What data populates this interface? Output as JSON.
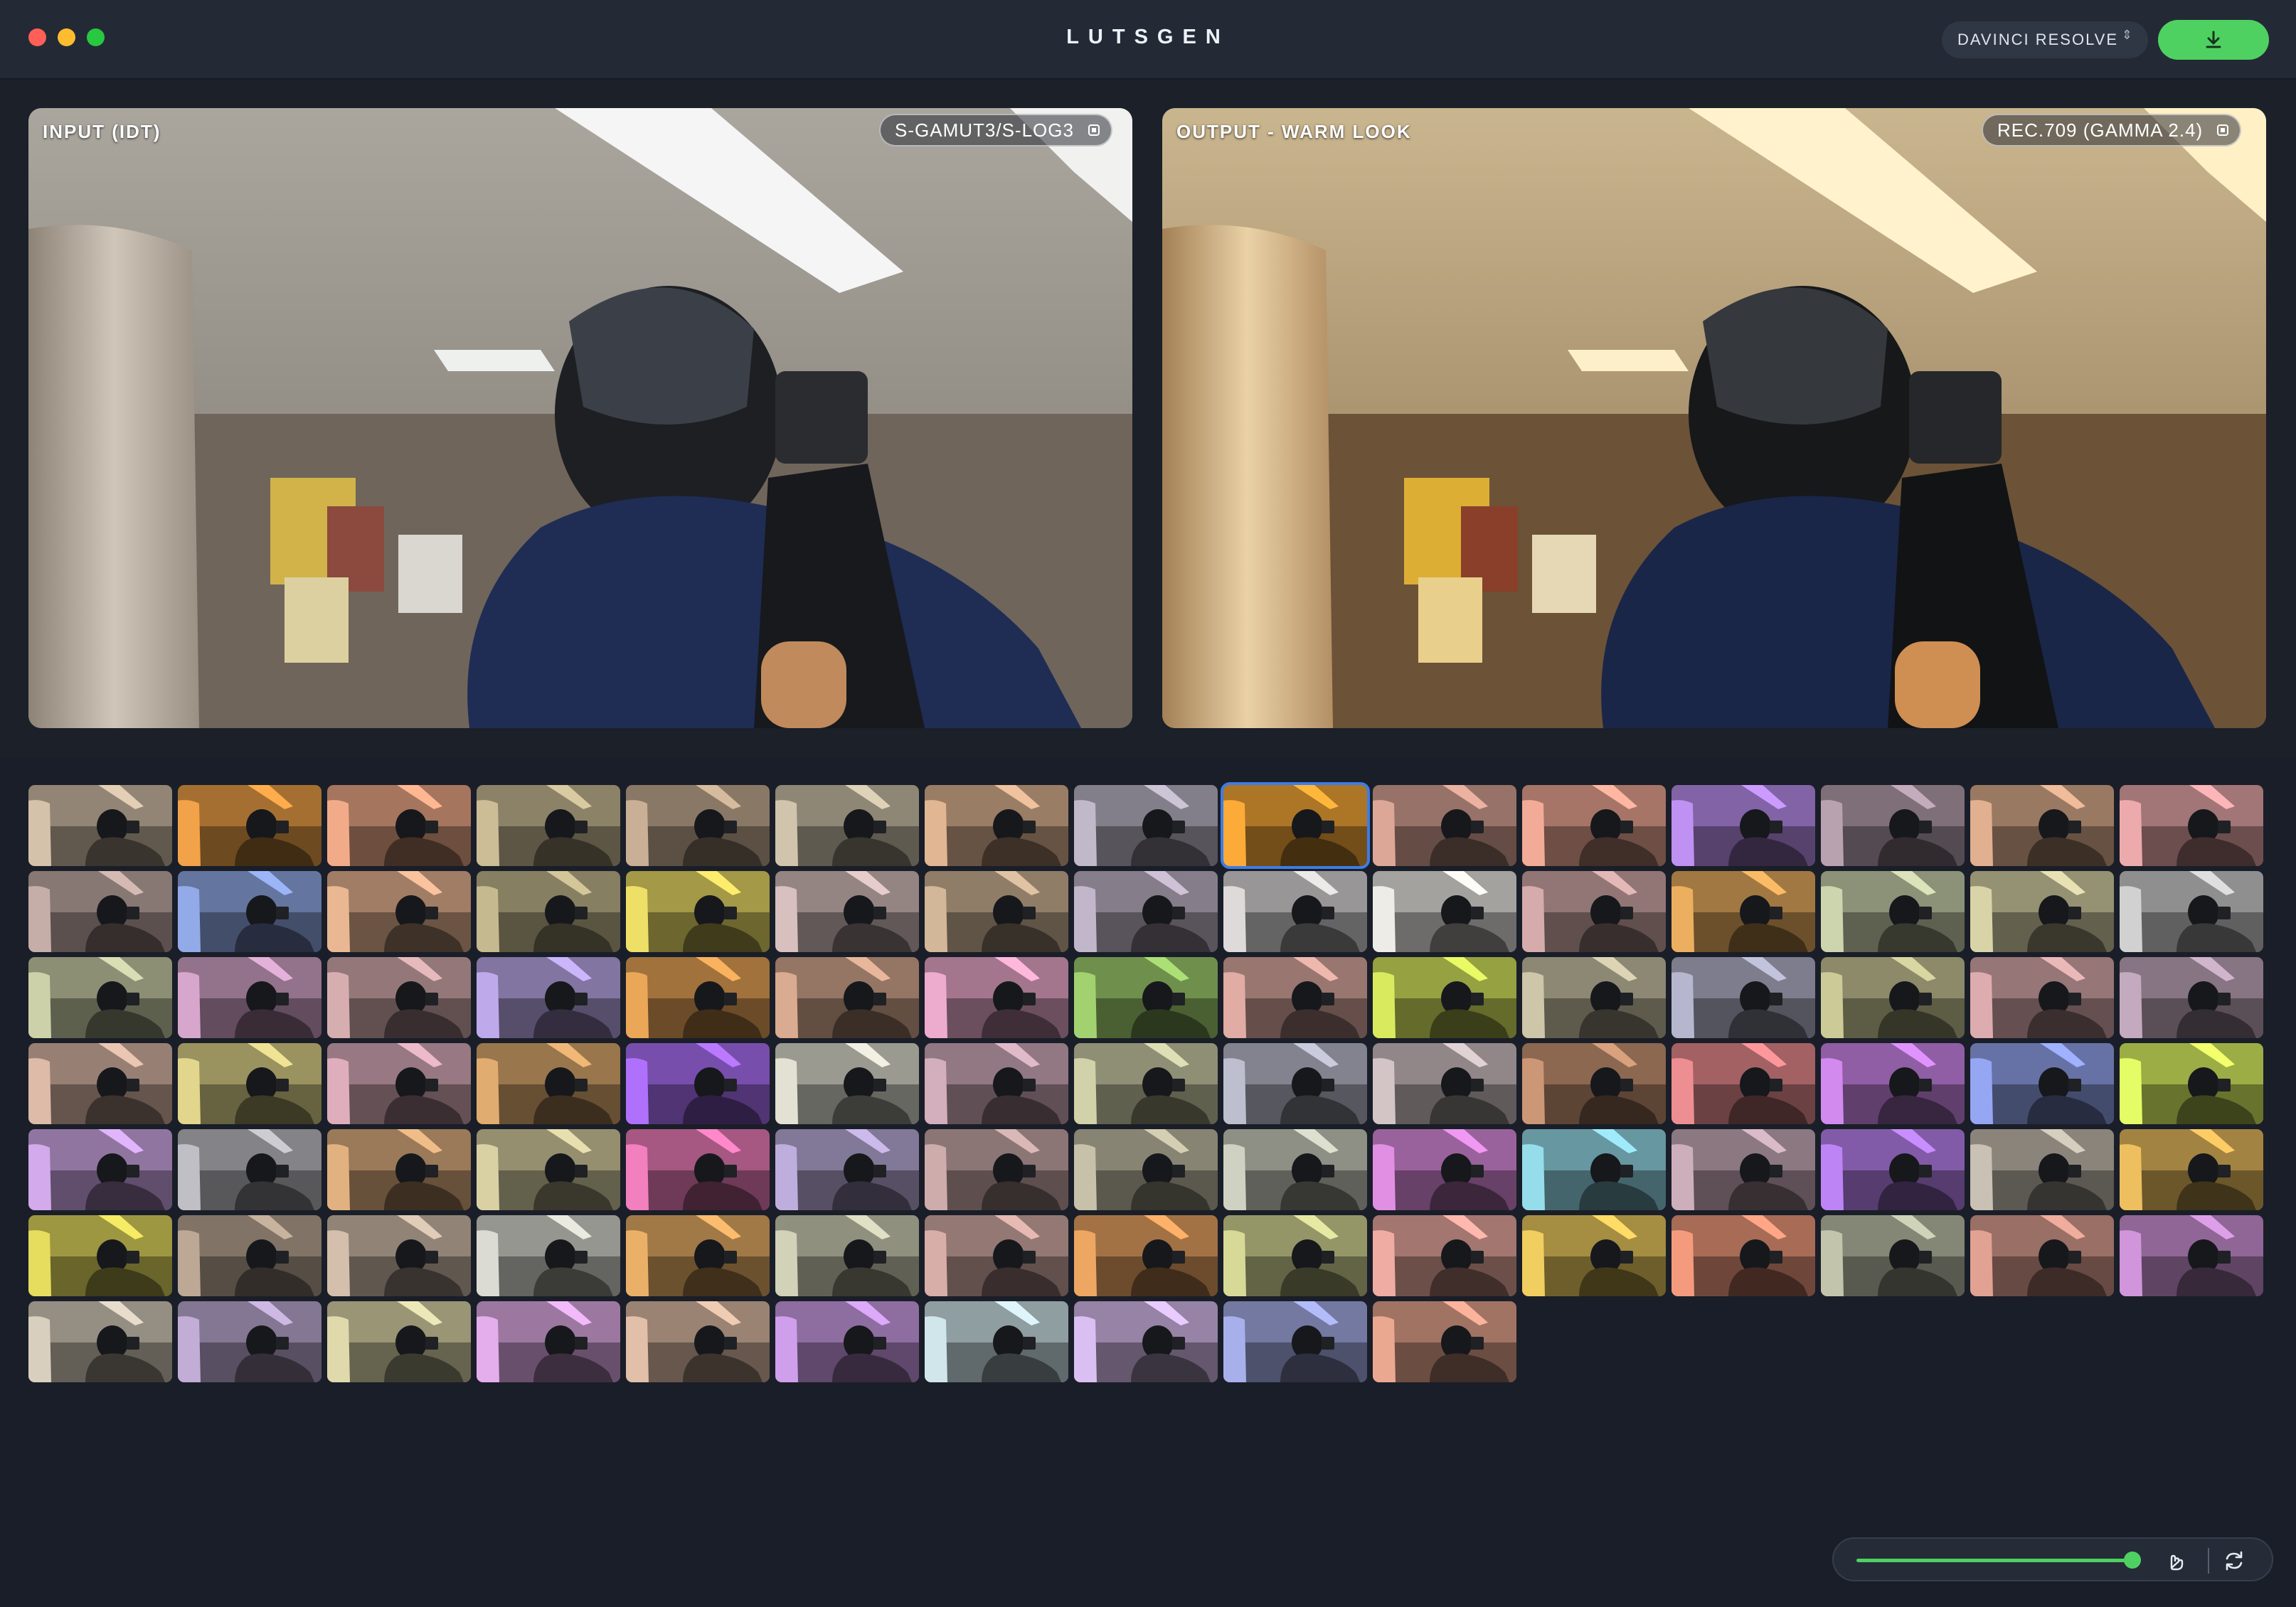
{
  "app": {
    "title": "LUTSGEN"
  },
  "header": {
    "target_app": "DAVINCI RESOLVE",
    "target_chevron": "⇕",
    "export_icon": "download-icon",
    "accent_color": "#4fd162"
  },
  "input_view": {
    "label": "INPUT (IDT)",
    "color_space": "S-GAMUT3/S-LOG3"
  },
  "output_view": {
    "label": "OUTPUT - WARM LOOK",
    "color_space": "REC.709 (GAMMA 2.4)"
  },
  "gallery": {
    "selected_index": 8,
    "selection_color": "#3d7ce6",
    "tints": [
      "#cbb9a2",
      "#e69a45",
      "#e6a382",
      "#c2b490",
      "#bfa78e",
      "#c6bca4",
      "#d6ad8c",
      "#b6b0bf",
      "#f0a335",
      "#d29f90",
      "#e6a390",
      "#b58ae6",
      "#b09aa8",
      "#d6a889",
      "#e1a2a4",
      "#bda6a0",
      "#8ba2dd",
      "#dfae8c",
      "#bcb188",
      "#e3d461",
      "#cdb7b5",
      "#c8ae91",
      "#b9adc0",
      "#d3d0d0",
      "#e3e1dc",
      "#cba4a3",
      "#e0a75a",
      "#c3cba6",
      "#cfc9a0",
      "#c6c7c6",
      "#c2c7a1",
      "#cc9ec3",
      "#cda6a8",
      "#b5a2e0",
      "#e09f54",
      "#cfa38a",
      "#e2a4c4",
      "#9ac86a",
      "#d5a49c",
      "#d0df5a",
      "#c4bda1",
      "#adaec4",
      "#c2c090",
      "#d2a4a6",
      "#bba2b6",
      "#d2b2a0",
      "#d6cc84",
      "#d3a6b4",
      "#d6a46a",
      "#a76cf0",
      "#d7d6ca",
      "#c9a6b4",
      "#c7c7a2",
      "#b4b6c5",
      "#c9bcbd",
      "#c29070",
      "#e2878b",
      "#c883e4",
      "#8e9ee6",
      "#d9f060",
      "#c9a2e0",
      "#b7b6bc",
      "#d6a97a",
      "#cfc79c",
      "#e679b5",
      "#b5a6d2",
      "#c3a4a3",
      "#bdb8a0",
      "#c5c8b9",
      "#d688d8",
      "#8fd2e0",
      "#c3a7b3",
      "#b37ee8",
      "#bfb8aa",
      "#e2b65a",
      "#dbd25a",
      "#b3a08e",
      "#c9b6a4",
      "#d1d1c9",
      "#e0a862",
      "#c7c8af",
      "#cda6a0",
      "#e39e5e",
      "#cdd090",
      "#e3a49b",
      "#e5c45a",
      "#e89478",
      "#b9bca4",
      "#d69a8c",
      "#c68ed0",
      "#cfc5b6",
      "#b8a5cc",
      "#d4cfa3",
      "#d8a6e0",
      "#d6b6a0",
      "#c597e0",
      "#c7dbe0",
      "#d0b6e6",
      "#a0a8e0",
      "#e0a08a"
    ]
  },
  "controls": {
    "intensity": 1.0,
    "compare_icon": "hand-icon",
    "regenerate_icon": "refresh-icon"
  }
}
